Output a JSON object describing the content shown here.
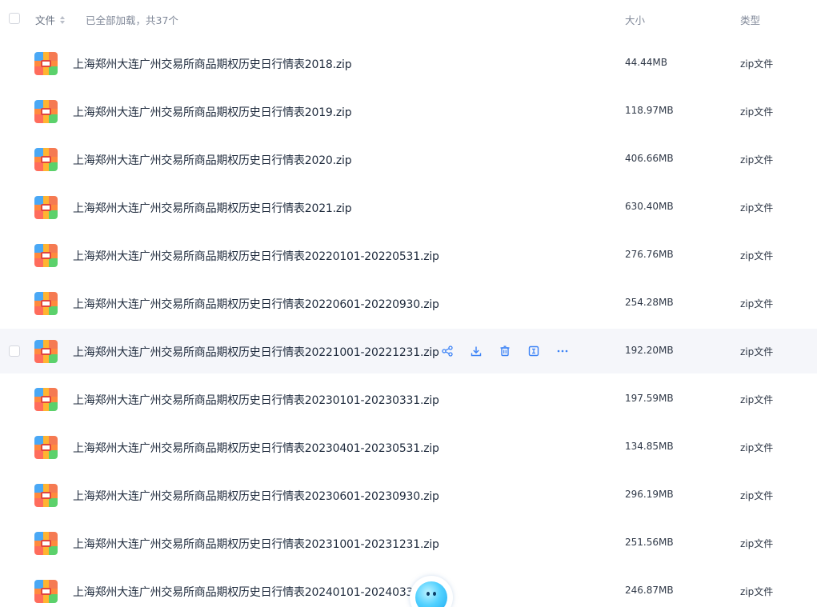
{
  "header": {
    "name_label": "文件",
    "load_status": "已全部加载，共37个",
    "size_label": "大小",
    "type_label": "类型"
  },
  "files": [
    {
      "name": "上海郑州大连广州交易所商品期权历史日行情表2018.zip",
      "size": "44.44MB",
      "type": "zip文件"
    },
    {
      "name": "上海郑州大连广州交易所商品期权历史日行情表2019.zip",
      "size": "118.97MB",
      "type": "zip文件"
    },
    {
      "name": "上海郑州大连广州交易所商品期权历史日行情表2020.zip",
      "size": "406.66MB",
      "type": "zip文件"
    },
    {
      "name": "上海郑州大连广州交易所商品期权历史日行情表2021.zip",
      "size": "630.40MB",
      "type": "zip文件"
    },
    {
      "name": "上海郑州大连广州交易所商品期权历史日行情表20220101-20220531.zip",
      "size": "276.76MB",
      "type": "zip文件"
    },
    {
      "name": "上海郑州大连广州交易所商品期权历史日行情表20220601-20220930.zip",
      "size": "254.28MB",
      "type": "zip文件"
    },
    {
      "name": "上海郑州大连广州交易所商品期权历史日行情表20221001-20221231.zip",
      "size": "192.20MB",
      "type": "zip文件"
    },
    {
      "name": "上海郑州大连广州交易所商品期权历史日行情表20230101-20230331.zip",
      "size": "197.59MB",
      "type": "zip文件"
    },
    {
      "name": "上海郑州大连广州交易所商品期权历史日行情表20230401-20230531.zip",
      "size": "134.85MB",
      "type": "zip文件"
    },
    {
      "name": "上海郑州大连广州交易所商品期权历史日行情表20230601-20230930.zip",
      "size": "296.19MB",
      "type": "zip文件"
    },
    {
      "name": "上海郑州大连广州交易所商品期权历史日行情表20231001-20231231.zip",
      "size": "251.56MB",
      "type": "zip文件"
    },
    {
      "name": "上海郑州大连广州交易所商品期权历史日行情表20240101-2024033",
      "size": "246.87MB",
      "type": "zip文件"
    }
  ],
  "hovered_row": 6,
  "row_actions": [
    "share-icon",
    "download-icon",
    "delete-icon",
    "rename-icon",
    "more-icon"
  ],
  "colors": {
    "hover_background": "#f5f6fa",
    "action_icon": "#3b82f6"
  }
}
